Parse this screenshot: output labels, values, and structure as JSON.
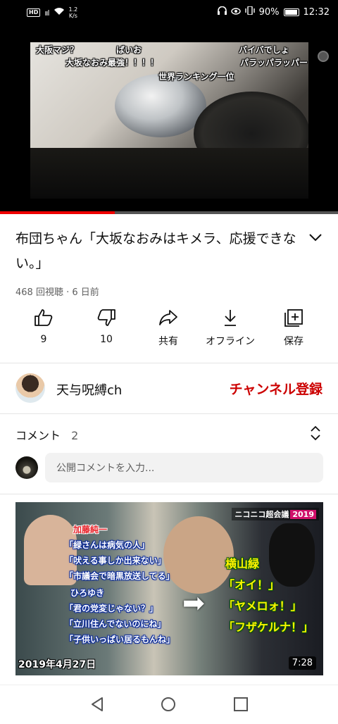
{
  "status_bar": {
    "hd": "HD",
    "signal": "ııl",
    "net_speed": "1.2",
    "net_unit": "K/s",
    "battery": "90%",
    "time": "12:32"
  },
  "player": {
    "danmaku": [
      "大阪マジ？",
      "ばいお",
      "バイバでしょ",
      "大坂なおみ最強！！！！",
      "パラッパラッパー",
      "世界ランキング一位"
    ],
    "progress": 0.34
  },
  "video": {
    "title": "布団ちゃん「大坂なおみはキメラ、応援できない。」",
    "meta": "468 回視聴 · 6 日前"
  },
  "actions": [
    {
      "icon": "thumbs-up-icon",
      "label": "9"
    },
    {
      "icon": "thumbs-down-icon",
      "label": "10"
    },
    {
      "icon": "share-icon",
      "label": "共有"
    },
    {
      "icon": "download-icon",
      "label": "オフライン"
    },
    {
      "icon": "save-icon",
      "label": "保存"
    }
  ],
  "channel": {
    "name": "天与呪縛ch",
    "subscribe_label": "チャンネル登録"
  },
  "comments": {
    "header": "コメント",
    "count": "2",
    "placeholder": "公開コメントを入力..."
  },
  "next_video": {
    "thumb_texts": {
      "name1": "加藤純一",
      "q1": "「緑さんは病気の人」",
      "q2": "「吠える事しか出来ない」",
      "q3": "「市議会で暗黒放送してる」",
      "name2": "ひろゆき",
      "q4": "「君の党変じゃない？」",
      "q5": "「立川住んでないのにね」",
      "q6": "「子供いっぱい居るもんね」",
      "name3": "横山緑",
      "y1": "「オイ！」",
      "y2": "「ヤメロォ！」",
      "y3": "「フザケルナ！」",
      "event": "ニコニコ超会議",
      "event_year": "2019"
    },
    "date_overlay": "2019年4月27日",
    "duration": "7:28"
  },
  "colors": {
    "accent_red": "#cc0000",
    "progress_red": "#ee0000",
    "text_secondary": "#606060"
  }
}
